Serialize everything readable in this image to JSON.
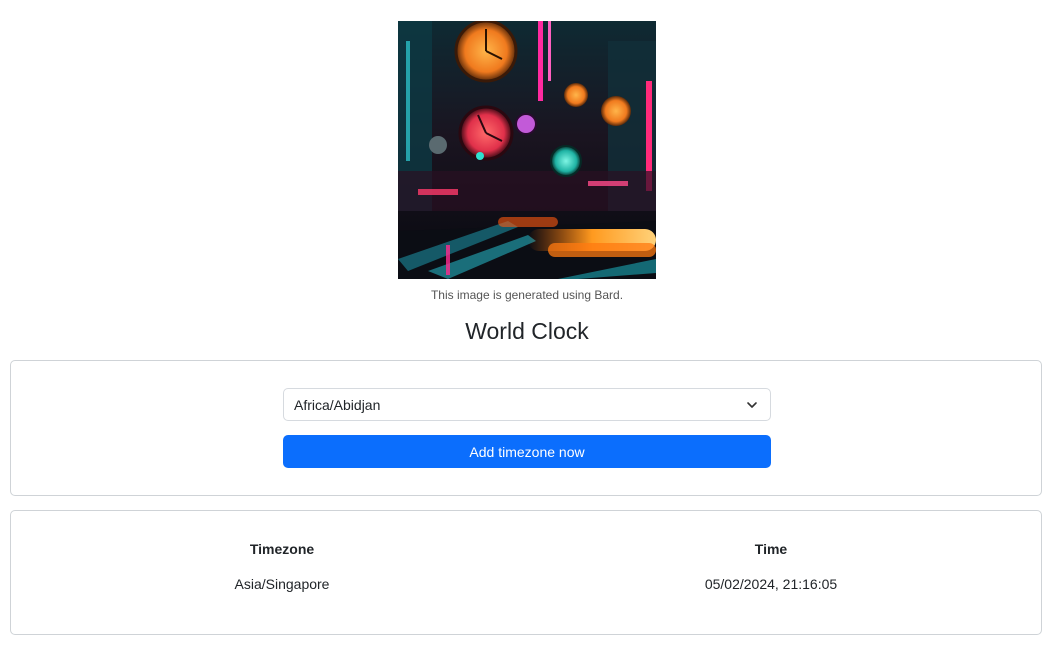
{
  "hero": {
    "caption": "This image is generated using Bard."
  },
  "page": {
    "title": "World Clock"
  },
  "form": {
    "timezone_select_value": "Africa/Abidjan",
    "add_button_label": "Add timezone now"
  },
  "table": {
    "headers": [
      "Timezone",
      "Time"
    ],
    "rows": [
      [
        "Asia/Singapore",
        "05/02/2024, 21:16:05"
      ]
    ]
  },
  "colors": {
    "primary": "#0b6efd",
    "border": "#cfd3d7"
  }
}
